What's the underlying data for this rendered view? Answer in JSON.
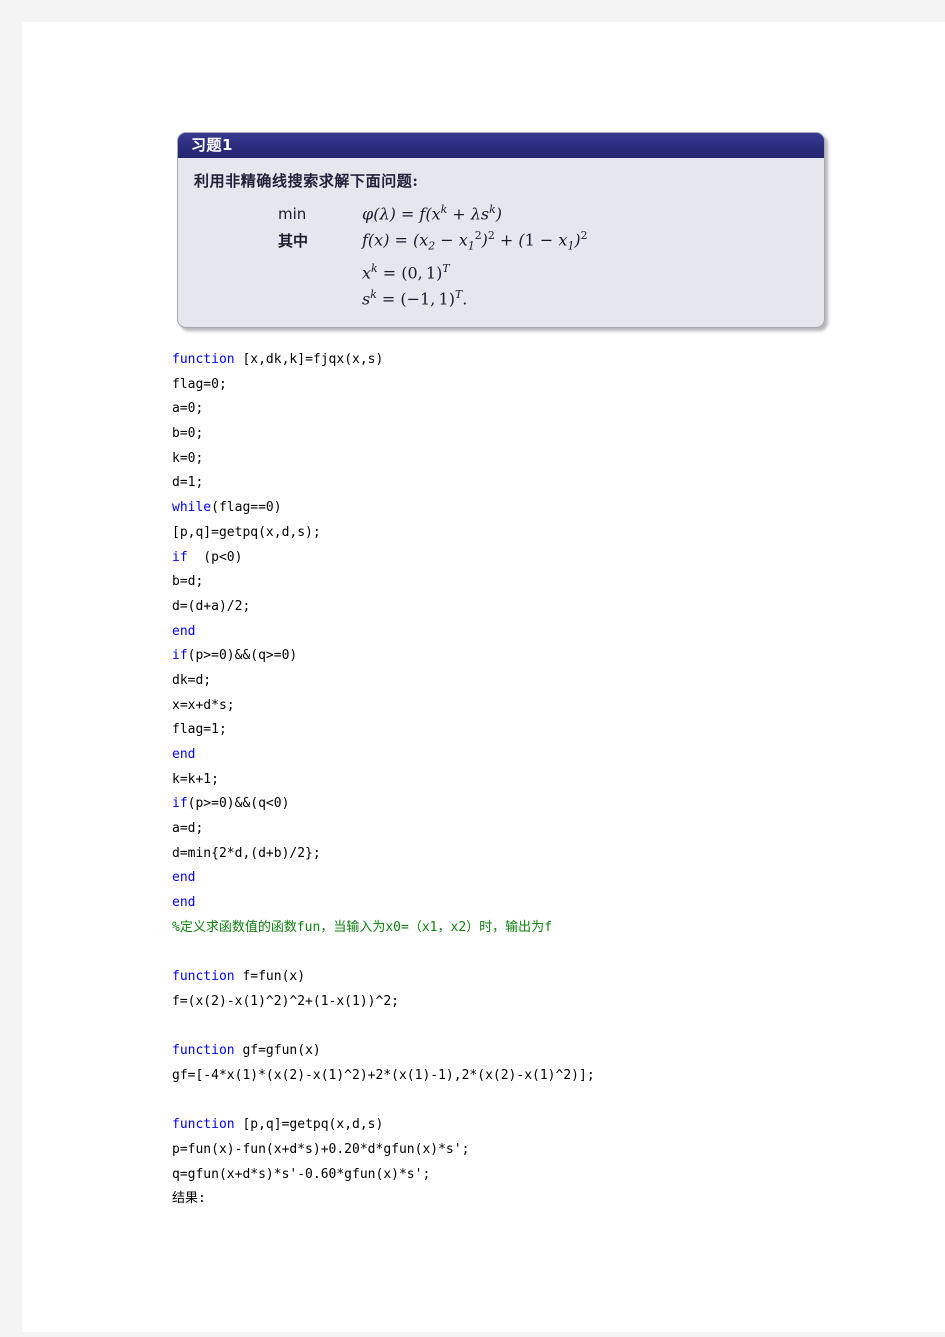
{
  "page": {
    "canvas_color": "#f4f4f4",
    "sheet_color": "#ffffff"
  },
  "problem_box": {
    "header_title": "习题1",
    "header_bg": "#2e2e84",
    "body_bg": "#e6e6ef",
    "border_color": "#a8a8b4",
    "prompt": "利用非精确线搜索求解下面问题:",
    "math": [
      {
        "keyword": "min",
        "keyword_lang": "latin",
        "expression": "φ(λ) = f(x^k + λs^k)"
      },
      {
        "keyword": "其中",
        "keyword_lang": "cjk",
        "expression": "f(x) = (x₂ − x₁²)² + (1 − x₁)²"
      },
      {
        "keyword": "",
        "keyword_lang": "latin",
        "expression": "x^k = (0, 1)^T"
      },
      {
        "keyword": "",
        "keyword_lang": "latin",
        "expression": "s^k = (−1, 1)^T."
      }
    ]
  },
  "code": {
    "keyword_color": "#0000ff",
    "comment_color": "#108010",
    "text_color": "#000000",
    "lines": [
      {
        "type": "kwline",
        "keyword": "function",
        "rest": " [x,dk,k]=fjqx(x,s)"
      },
      {
        "type": "plain",
        "text": "flag=0;"
      },
      {
        "type": "plain",
        "text": "a=0;"
      },
      {
        "type": "plain",
        "text": "b=0;"
      },
      {
        "type": "plain",
        "text": "k=0;"
      },
      {
        "type": "plain",
        "text": "d=1;"
      },
      {
        "type": "kwline",
        "keyword": "while",
        "rest": "(flag==0)"
      },
      {
        "type": "plain",
        "text": "[p,q]=getpq(x,d,s);"
      },
      {
        "type": "kwline",
        "keyword": "if",
        "rest": "  (p<0)"
      },
      {
        "type": "plain",
        "text": "b=d;"
      },
      {
        "type": "plain",
        "text": "d=(d+a)/2;"
      },
      {
        "type": "kwline",
        "keyword": "end",
        "rest": ""
      },
      {
        "type": "kwline",
        "keyword": "if",
        "rest": "(p>=0)&&(q>=0)"
      },
      {
        "type": "plain",
        "text": "dk=d;"
      },
      {
        "type": "plain",
        "text": "x=x+d*s;"
      },
      {
        "type": "plain",
        "text": "flag=1;"
      },
      {
        "type": "kwline",
        "keyword": "end",
        "rest": ""
      },
      {
        "type": "plain",
        "text": "k=k+1;"
      },
      {
        "type": "kwline",
        "keyword": "if",
        "rest": "(p>=0)&&(q<0)"
      },
      {
        "type": "plain",
        "text": "a=d;"
      },
      {
        "type": "plain",
        "text": "d=min{2*d,(d+b)/2};"
      },
      {
        "type": "kwline",
        "keyword": "end",
        "rest": ""
      },
      {
        "type": "kwline",
        "keyword": "end",
        "rest": ""
      },
      {
        "type": "comment",
        "text": "%定义求函数值的函数fun，当输入为x0=（x1，x2）时，输出为f"
      },
      {
        "type": "blank",
        "text": " "
      },
      {
        "type": "kwline",
        "keyword": "function",
        "rest": " f=fun(x)"
      },
      {
        "type": "plain",
        "text": "f=(x(2)-x(1)^2)^2+(1-x(1))^2;"
      },
      {
        "type": "blank",
        "text": " "
      },
      {
        "type": "kwline",
        "keyword": "function",
        "rest": " gf=gfun(x)"
      },
      {
        "type": "plain",
        "text": "gf=[-4*x(1)*(x(2)-x(1)^2)+2*(x(1)-1),2*(x(2)-x(1)^2)];"
      },
      {
        "type": "blank",
        "text": " "
      },
      {
        "type": "kwline",
        "keyword": "function",
        "rest": " [p,q]=getpq(x,d,s)"
      },
      {
        "type": "plain",
        "text": "p=fun(x)-fun(x+d*s)+0.20*d*gfun(x)*s';"
      },
      {
        "type": "plain",
        "text": "q=gfun(x+d*s)*s'-0.60*gfun(x)*s';"
      },
      {
        "type": "plain",
        "text": "结果:"
      }
    ]
  }
}
